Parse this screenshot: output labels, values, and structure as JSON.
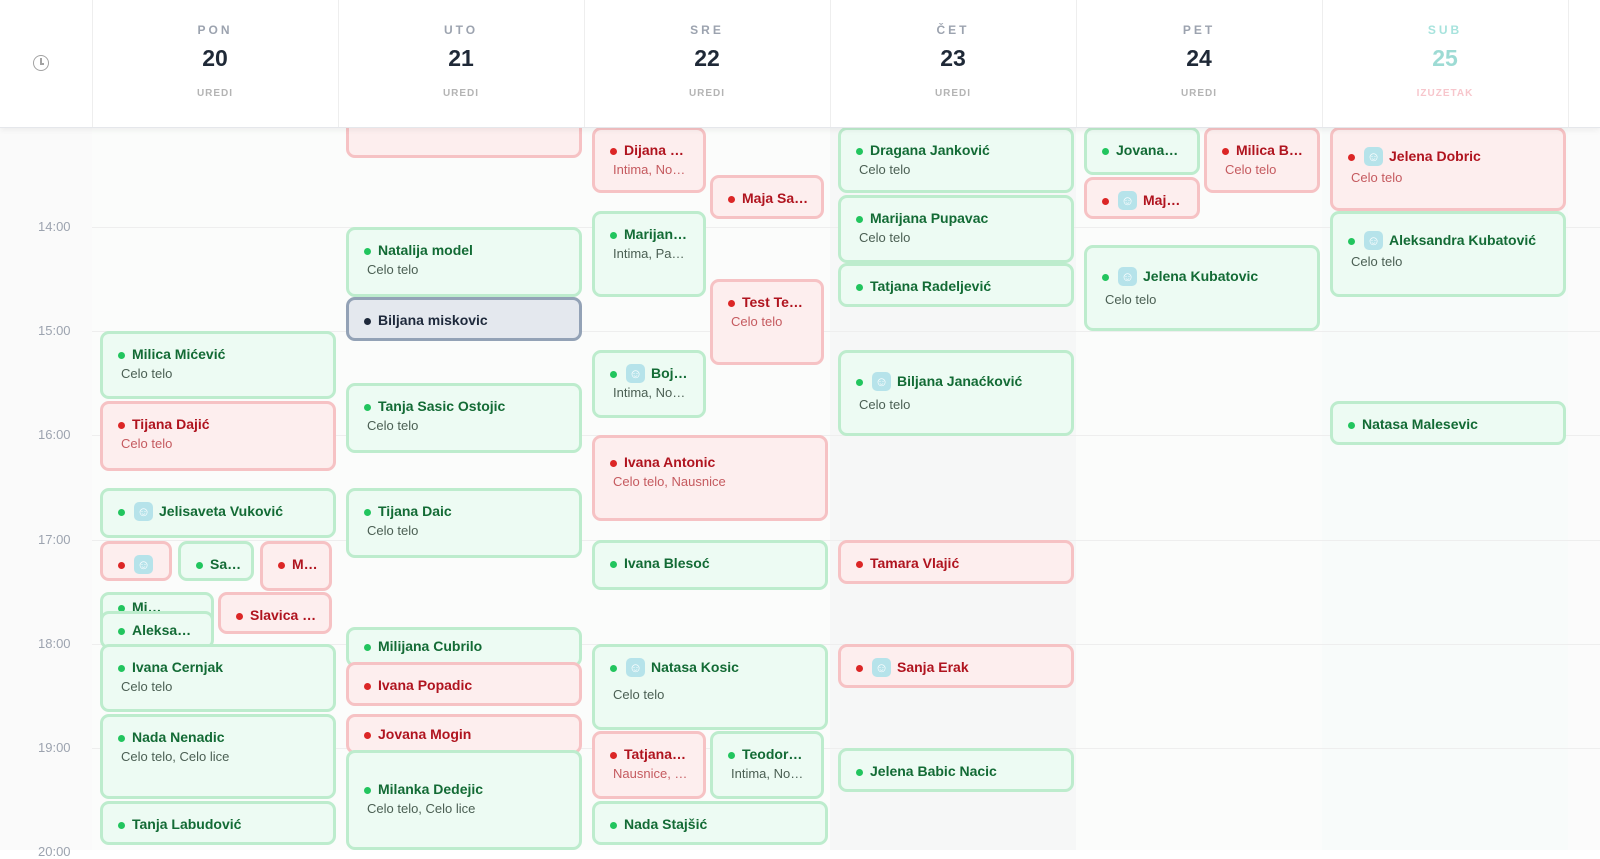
{
  "days": [
    {
      "name": "PON",
      "num": "20",
      "link": "UREDI"
    },
    {
      "name": "UTO",
      "num": "21",
      "link": "UREDI"
    },
    {
      "name": "SRE",
      "num": "22",
      "link": "UREDI"
    },
    {
      "name": "ČET",
      "num": "23",
      "link": "UREDI"
    },
    {
      "name": "PET",
      "num": "24",
      "link": "UREDI"
    },
    {
      "name": "SUB",
      "num": "25",
      "link": "IZUZETAK"
    }
  ],
  "times": [
    "14:00",
    "15:00",
    "16:00",
    "17:00",
    "18:00",
    "19:00",
    "20:00"
  ],
  "events": [
    {
      "id": "e1",
      "title": "Milica Mićević",
      "sub": "Celo telo",
      "status": "green"
    },
    {
      "id": "e2",
      "title": "Tijana Dajić",
      "sub": "Celo telo",
      "status": "red"
    },
    {
      "id": "e3",
      "title": "Jelisaveta Vuković",
      "sub": "",
      "status": "green"
    },
    {
      "id": "e4",
      "title": "",
      "sub": "",
      "status": "red"
    },
    {
      "id": "e5",
      "title": "Sa…",
      "sub": "",
      "status": "green"
    },
    {
      "id": "e6",
      "title": "M…",
      "sub": "",
      "status": "red"
    },
    {
      "id": "e7",
      "title": "Mi…",
      "sub": "",
      "status": "green"
    },
    {
      "id": "e8",
      "title": "Aleksa…",
      "sub": "",
      "status": "green"
    },
    {
      "id": "e9",
      "title": "Slavica …",
      "sub": "",
      "status": "red"
    },
    {
      "id": "e10",
      "title": "Ivana Cernjak",
      "sub": "Celo telo",
      "status": "green"
    },
    {
      "id": "e11",
      "title": "Nada Nenadic",
      "sub": "Celo telo, Celo lice",
      "status": "green"
    },
    {
      "id": "e12",
      "title": "Tanja Labudović",
      "sub": "",
      "status": "green"
    },
    {
      "id": "e13",
      "title": "",
      "sub": "",
      "status": "red"
    },
    {
      "id": "e14",
      "title": "Natalija model",
      "sub": "Celo telo",
      "status": "green"
    },
    {
      "id": "e15",
      "title": "Biljana miskovic",
      "sub": "",
      "status": "selected"
    },
    {
      "id": "e16",
      "title": "Tanja Sasic Ostojic",
      "sub": "Celo telo",
      "status": "green"
    },
    {
      "id": "e17",
      "title": "Tijana Daic",
      "sub": "Celo telo",
      "status": "green"
    },
    {
      "id": "e18",
      "title": "Milijana Cubrilo",
      "sub": "",
      "status": "green"
    },
    {
      "id": "e19",
      "title": "Ivana Popadic",
      "sub": "",
      "status": "red"
    },
    {
      "id": "e20",
      "title": "Jovana Mogin",
      "sub": "",
      "status": "red"
    },
    {
      "id": "e21",
      "title": "Milanka Dedejic",
      "sub": "Celo telo, Celo lice",
      "status": "green"
    },
    {
      "id": "e22",
      "title": "Dijana …",
      "sub": "Intima, No…",
      "status": "red"
    },
    {
      "id": "e23",
      "title": "Maja Sa…",
      "sub": "",
      "status": "red"
    },
    {
      "id": "e24",
      "title": "Marijan…",
      "sub": "Intima, Pa…",
      "status": "green"
    },
    {
      "id": "e25",
      "title": "Test Te…",
      "sub": "Celo telo",
      "status": "red"
    },
    {
      "id": "e26",
      "title": "Boj…",
      "sub": "Intima, No…",
      "status": "green"
    },
    {
      "id": "e27",
      "title": "Ivana Antonic",
      "sub": "Celo telo, Nausnice",
      "status": "red"
    },
    {
      "id": "e28",
      "title": "Ivana Blesoć",
      "sub": "",
      "status": "green"
    },
    {
      "id": "e29",
      "title": "Natasa Kosic",
      "sub": "Celo telo",
      "status": "green"
    },
    {
      "id": "e30",
      "title": "Tatjana…",
      "sub": "Nausnice, …",
      "status": "red"
    },
    {
      "id": "e31",
      "title": "Teodor…",
      "sub": "Intima, No…",
      "status": "green"
    },
    {
      "id": "e32",
      "title": "Nada Stajšić",
      "sub": "",
      "status": "green"
    },
    {
      "id": "e33",
      "title": "Dragana Janković",
      "sub": "Celo telo",
      "status": "green"
    },
    {
      "id": "e34",
      "title": "Marijana Pupavac",
      "sub": "Celo telo",
      "status": "green"
    },
    {
      "id": "e35",
      "title": "Tatjana Radeljević",
      "sub": "",
      "status": "green"
    },
    {
      "id": "e36",
      "title": "Biljana Janaćković",
      "sub": "Celo telo",
      "status": "green"
    },
    {
      "id": "e37",
      "title": "Tamara Vlajić",
      "sub": "",
      "status": "red"
    },
    {
      "id": "e38",
      "title": "Sanja Erak",
      "sub": "",
      "status": "red"
    },
    {
      "id": "e39",
      "title": "Jelena Babic Nacic",
      "sub": "",
      "status": "green"
    },
    {
      "id": "e40",
      "title": "Jovana…",
      "sub": "",
      "status": "green"
    },
    {
      "id": "e41",
      "title": "Milica B…",
      "sub": "Celo telo",
      "status": "red"
    },
    {
      "id": "e42",
      "title": "Maj…",
      "sub": "",
      "status": "red"
    },
    {
      "id": "e43",
      "title": "Jelena Kubatovic",
      "sub": "Celo telo",
      "status": "green"
    },
    {
      "id": "e44",
      "title": "Jelena Dobric",
      "sub": "Celo telo",
      "status": "red"
    },
    {
      "id": "e45",
      "title": "Aleksandra Kubatović",
      "sub": "Celo telo",
      "status": "green"
    },
    {
      "id": "e46",
      "title": "Natasa Malesevic",
      "sub": "",
      "status": "green"
    }
  ],
  "icons": {
    "client": "user-badge-icon",
    "clock": "clock-icon"
  }
}
